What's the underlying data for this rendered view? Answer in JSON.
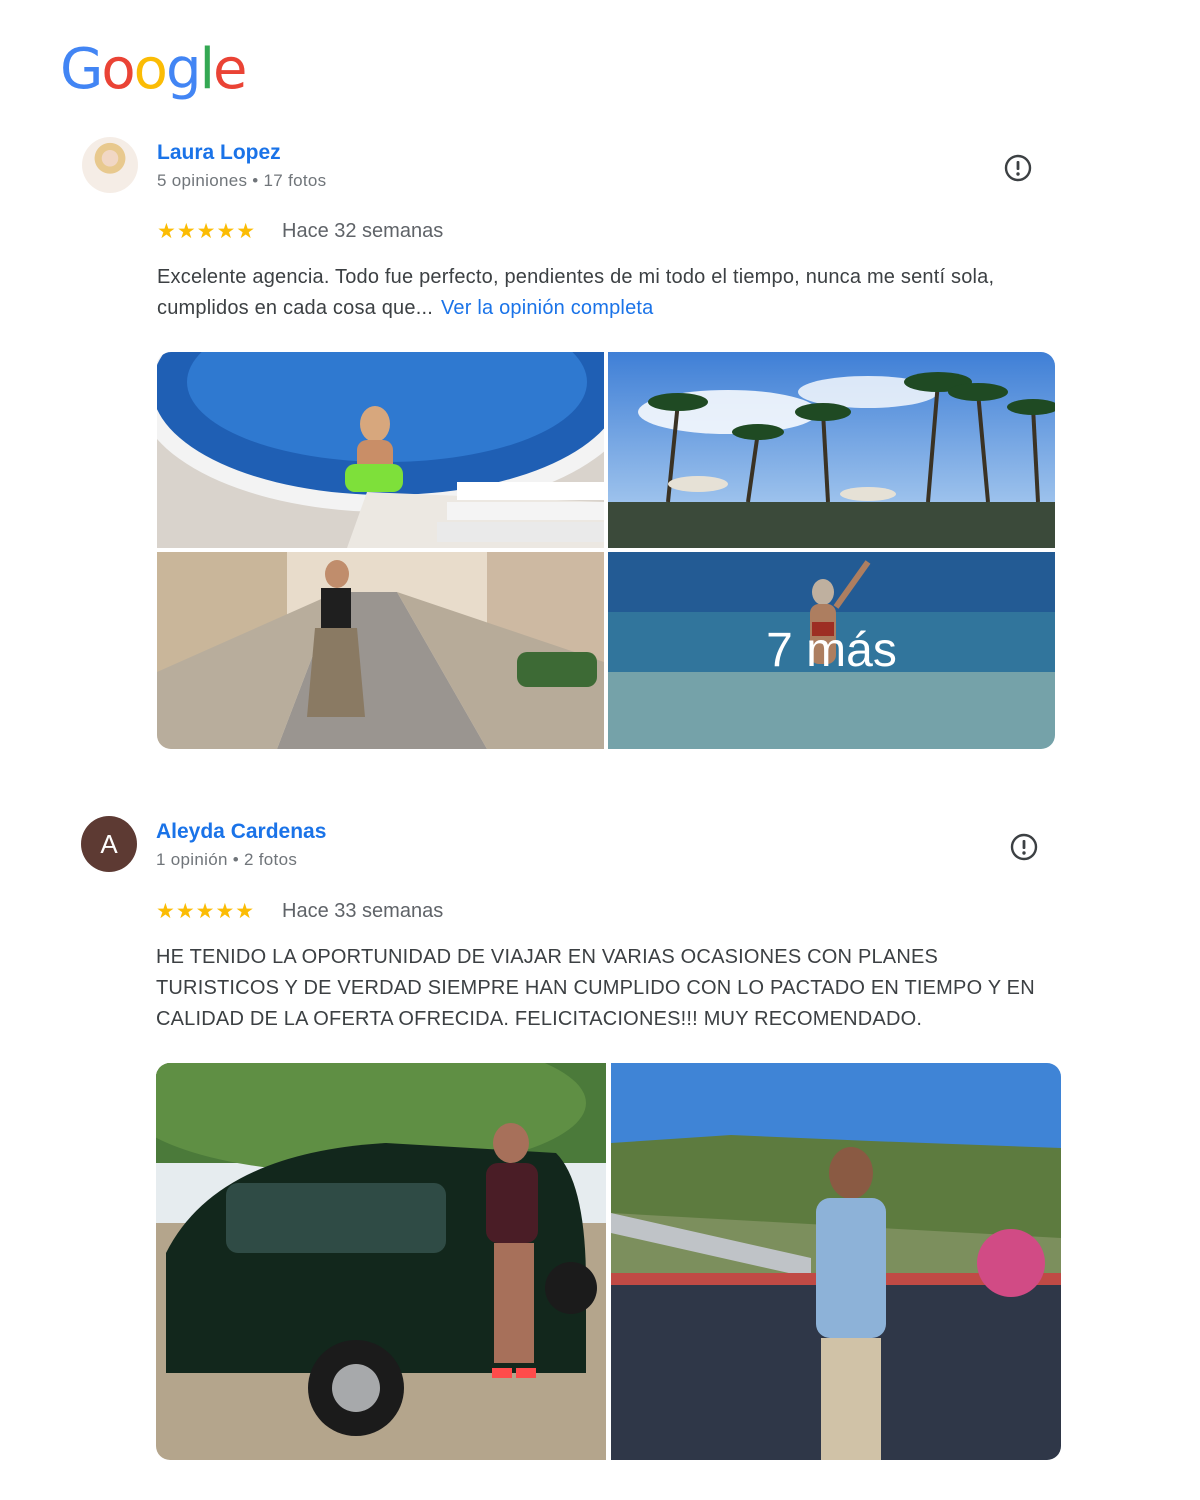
{
  "logo": {
    "text": "Google"
  },
  "reviews": [
    {
      "author": "Laura Lopez",
      "meta": "5 opiniones • 17 fotos",
      "rating": 5,
      "stars": "★★★★★",
      "date": "Hace 32 semanas",
      "text": "Excelente agencia. Todo fue perfecto, pendientes de mi todo el tiempo, nunca me sentí sola, cumplidos en cada cosa que...",
      "more_link": "Ver la opinión completa",
      "more_photos": "7 más"
    },
    {
      "author": "Aleyda Cardenas",
      "avatar_letter": "A",
      "meta": "1 opinión • 2 fotos",
      "rating": 5,
      "stars": "★★★★★",
      "date": "Hace 33 semanas",
      "text": "HE TENIDO LA OPORTUNIDAD DE VIAJAR EN VARIAS OCASIONES CON PLANES TURISTICOS Y DE VERDAD SIEMPRE HAN CUMPLIDO CON LO PACTADO EN TIEMPO Y EN CALIDAD DE LA OFERTA OFRECIDA. FELICITACIONES!!! MUY RECOMENDADO."
    }
  ],
  "colors": {
    "link": "#1a73e8",
    "star": "#fbbc04",
    "avatar_bg": "#5d3a33"
  }
}
